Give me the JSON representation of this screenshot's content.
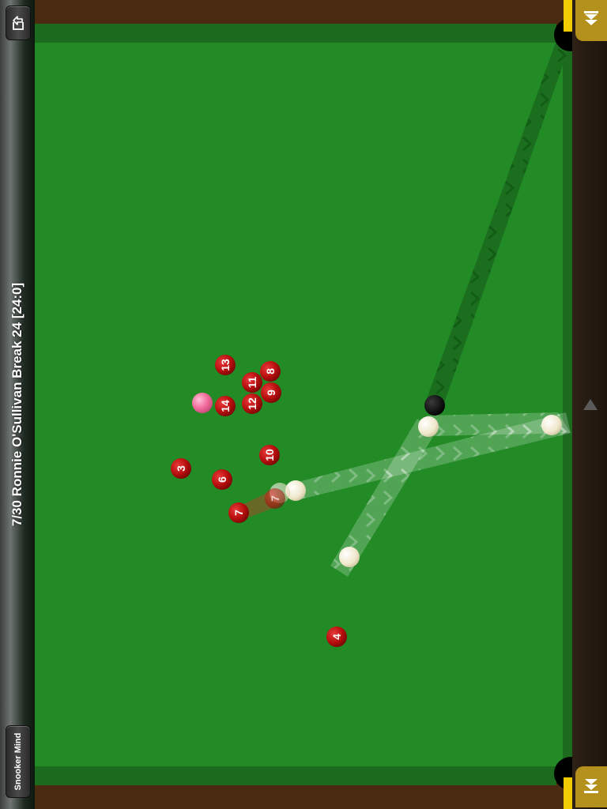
{
  "header": {
    "title": "7/30 Ronnie O'Sullivan Break 24 [24:0]"
  },
  "toolbar": {
    "back_icon": "export-back-icon",
    "app_label": "Snooker Mind",
    "next_icon": "fast-forward-icon",
    "prev_icon": "rewind-icon",
    "scroll_icon": "triangle-up-icon"
  },
  "colors": {
    "cloth": "#228b26",
    "cushion": "#1c6b1f",
    "wood": "#4a2a10",
    "red_ball": "#c01212",
    "pink_ball": "#f06a9a",
    "black_ball": "#0a0a0a",
    "cue_ball": "#f4efd8",
    "accent": "#f2cc00",
    "button": "#b4901c"
  },
  "balls": {
    "reds": [
      "13",
      "8",
      "11",
      "9",
      "14",
      "12",
      "10",
      "3",
      "6",
      "7",
      "4"
    ],
    "ghost_red": "7",
    "pink": "pink",
    "black": "black",
    "cue": "cue"
  }
}
